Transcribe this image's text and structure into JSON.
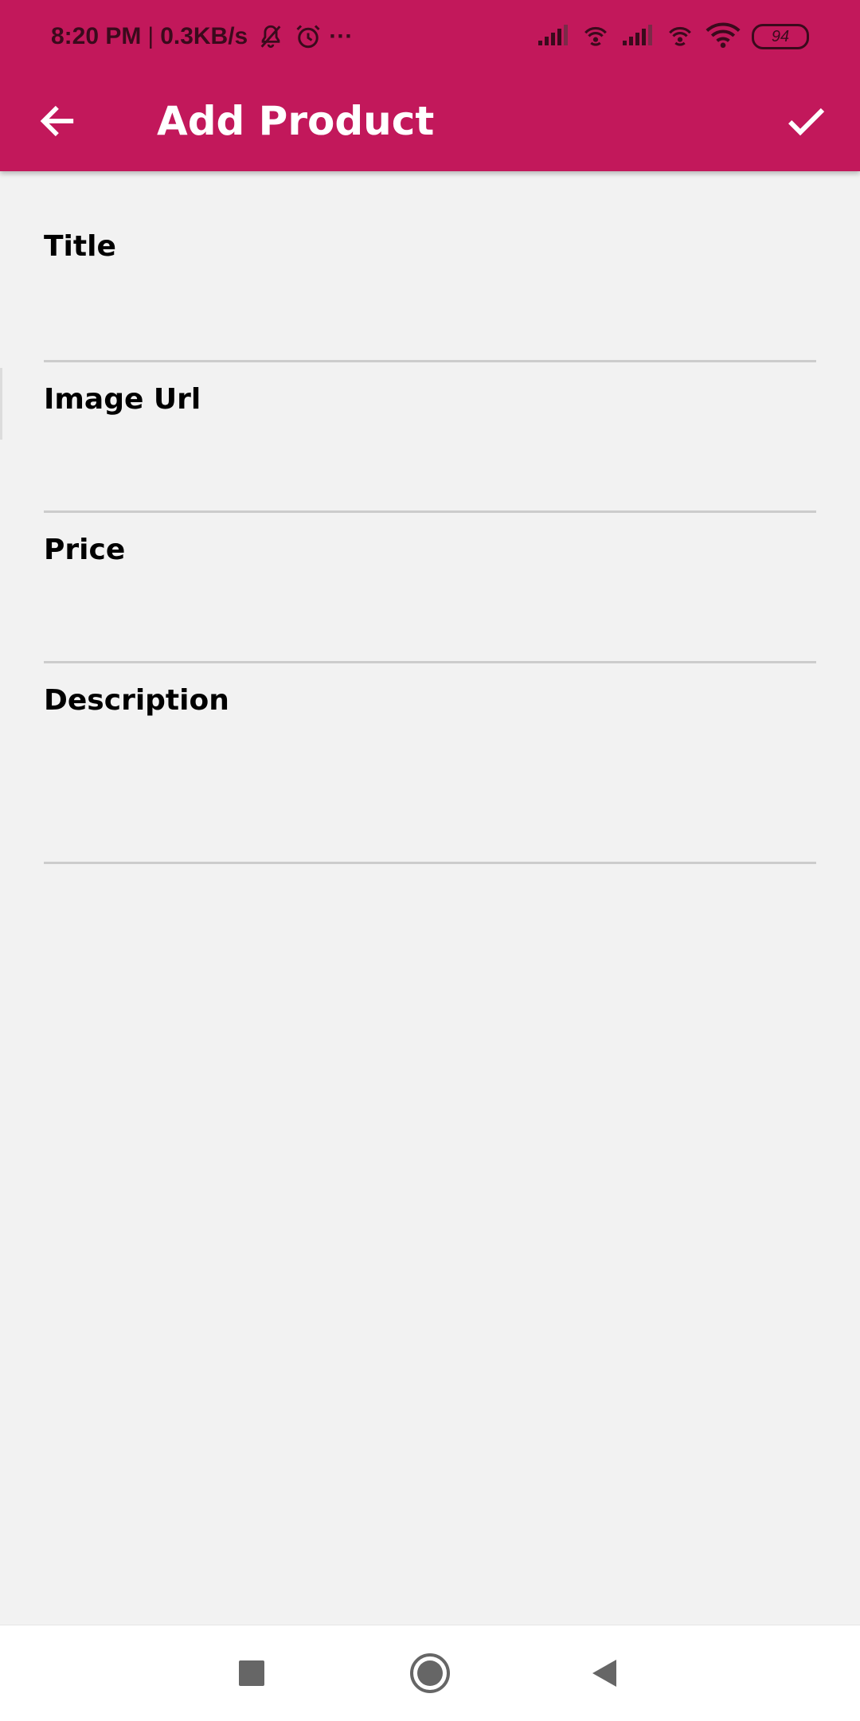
{
  "status_bar": {
    "time": "8:20 PM",
    "separator": "|",
    "net_speed": "0.3KB/s",
    "more": "···",
    "battery": "94",
    "icons": [
      "bell-off-icon",
      "alarm-icon",
      "signal-icon",
      "hotspot-icon",
      "signal-icon",
      "hotspot-icon",
      "wifi-icon",
      "battery-icon"
    ]
  },
  "appbar": {
    "title": "Add Product",
    "back_icon": "arrow-back-icon",
    "save_icon": "check-icon",
    "color": "#c2185b"
  },
  "form": {
    "fields": [
      {
        "label": "Title",
        "value": ""
      },
      {
        "label": "Image Url",
        "value": ""
      },
      {
        "label": "Price",
        "value": ""
      },
      {
        "label": "Description",
        "value": ""
      }
    ]
  },
  "nav_bar": {
    "buttons": [
      "recents-icon",
      "home-icon",
      "back-icon"
    ]
  }
}
